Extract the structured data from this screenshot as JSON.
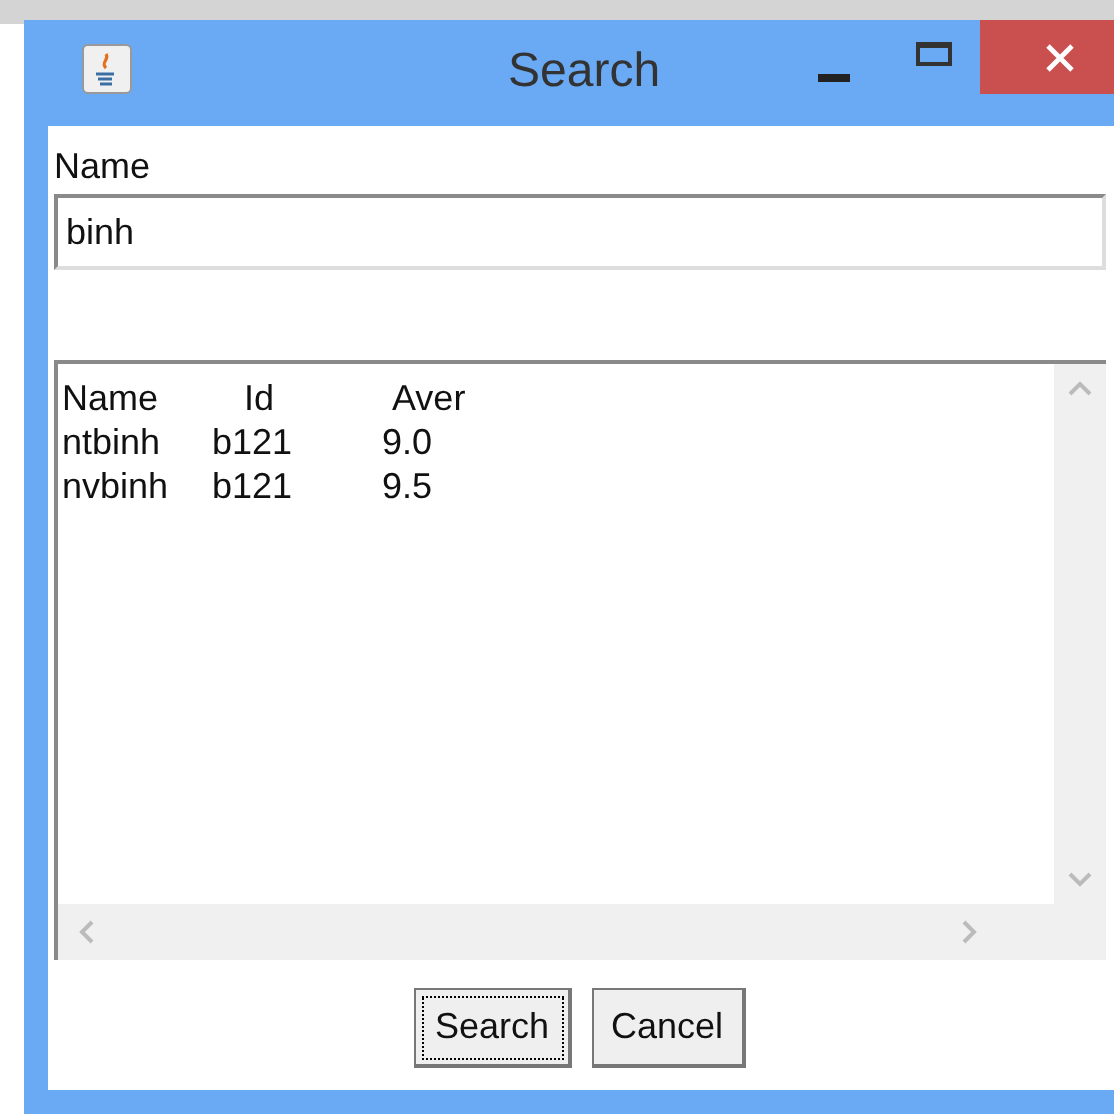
{
  "window": {
    "title": "Search"
  },
  "name_label": "Name",
  "name_field": {
    "value": "binh"
  },
  "results": {
    "lines": [
      {
        "kind": "header",
        "cells": [
          "Name",
          "Id",
          "Aver"
        ]
      },
      {
        "kind": "row",
        "cells": [
          "ntbinh",
          "b121",
          "9.0"
        ]
      },
      {
        "kind": "row",
        "cells": [
          "nvbinh",
          "b121",
          "9.5"
        ]
      }
    ]
  },
  "buttons": [
    {
      "label": "Search",
      "focused": true
    },
    {
      "label": "Cancel",
      "focused": false
    }
  ]
}
